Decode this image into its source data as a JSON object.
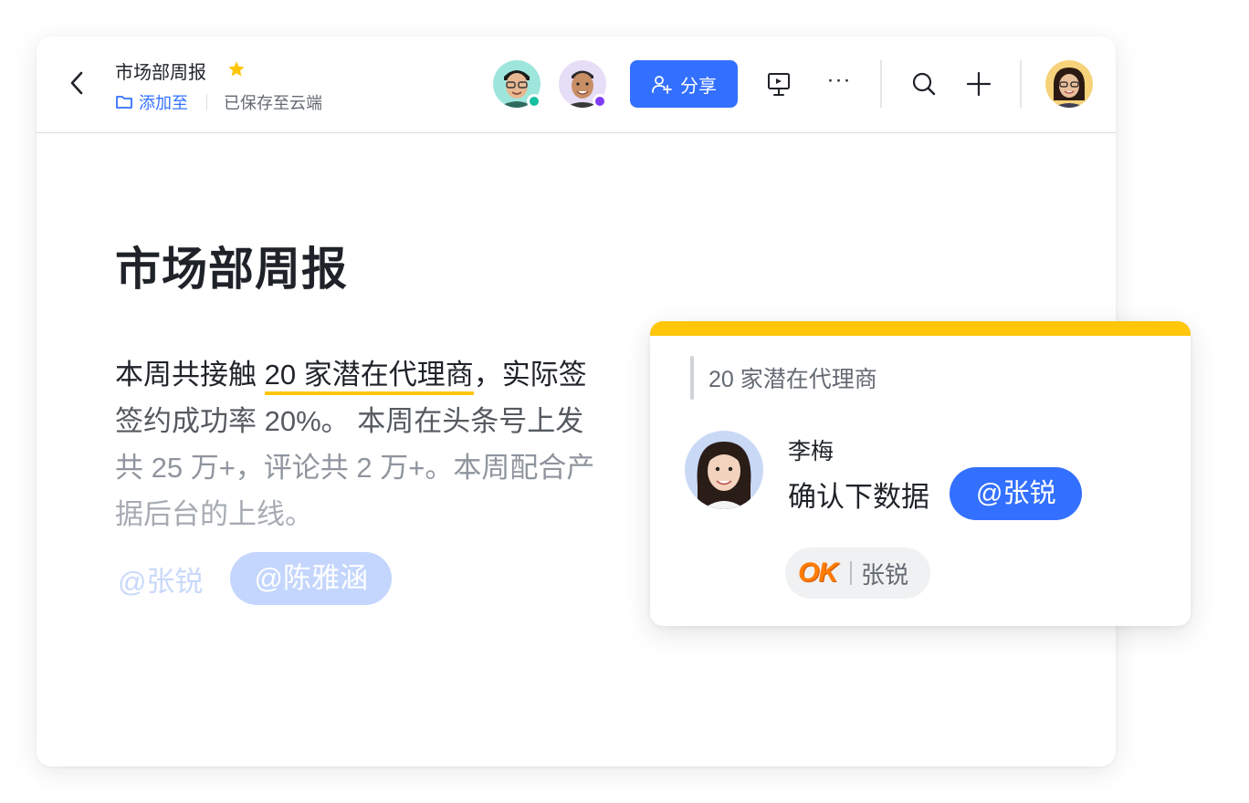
{
  "header": {
    "doc_title": "市场部周报",
    "add_to_label": "添加至",
    "saved_status": "已保存至云端",
    "share_label": "分享",
    "more_label": "···",
    "collaborators": [
      {
        "name": "collaborator-1",
        "presence_color": "#14c0a0"
      },
      {
        "name": "collaborator-2",
        "presence_color": "#7f3bf5"
      }
    ]
  },
  "document": {
    "title": "市场部周报",
    "paragraph": {
      "line1_pre": "本周共接触 ",
      "line1_highlight": "20 家潜在代理商",
      "line1_post": "，实际签",
      "line2": "签约成功率 20%。 本周在头条号上发",
      "line3": "共 25 万+，评论共 2 万+。本周配合产",
      "line4": "据后台的上线。"
    },
    "mentions": [
      "@张锐",
      "@陈雅涵"
    ]
  },
  "comment": {
    "quote": "20 家潜在代理商",
    "author": "李梅",
    "message": "确认下数据",
    "mention": "@张锐",
    "reaction": {
      "emoji": "OK",
      "user": "张锐"
    }
  },
  "colors": {
    "accent": "#3370ff",
    "highlight": "#ffc60a",
    "star": "#ffc60a"
  }
}
